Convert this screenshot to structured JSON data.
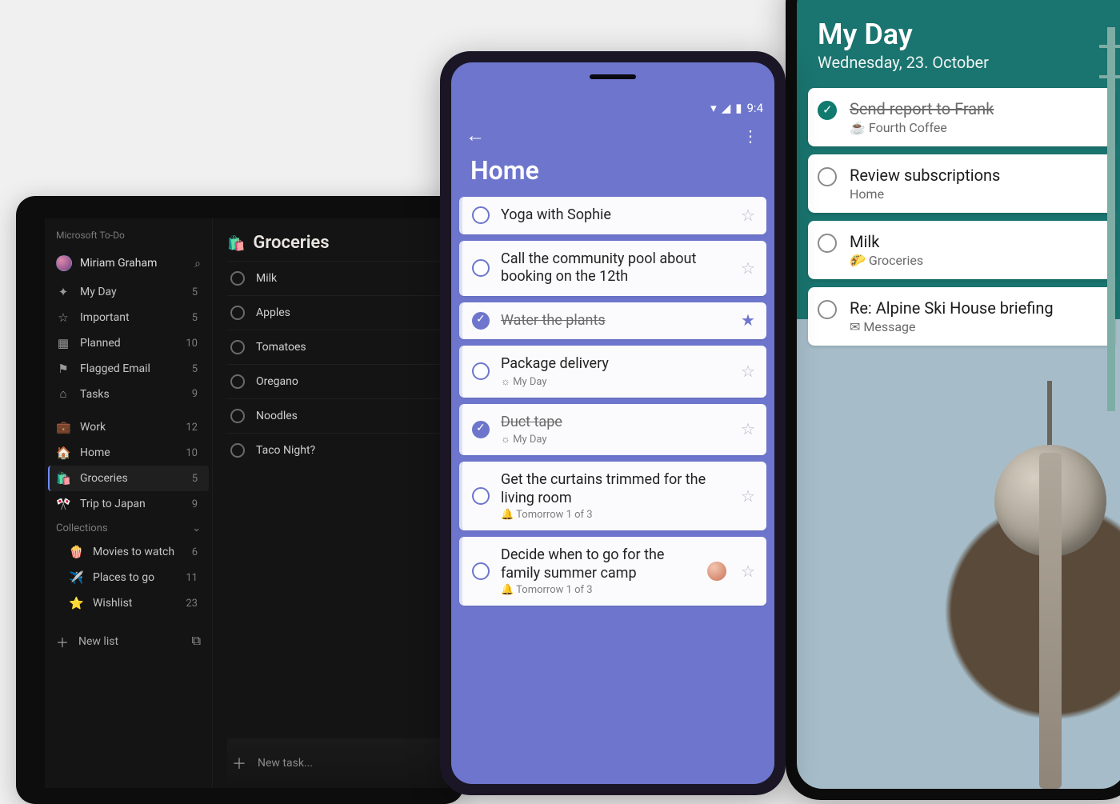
{
  "tablet": {
    "app_title": "Microsoft To-Do",
    "user_name": "Miriam Graham",
    "nav": [
      {
        "icon": "✦",
        "label": "My Day",
        "count": 5
      },
      {
        "icon": "☆",
        "label": "Important",
        "count": 5
      },
      {
        "icon": "▦",
        "label": "Planned",
        "count": 10
      },
      {
        "icon": "⚑",
        "label": "Flagged Email",
        "count": 5
      },
      {
        "icon": "⌂",
        "label": "Tasks",
        "count": 9
      }
    ],
    "lists": [
      {
        "icon": "💼",
        "label": "Work",
        "count": 12,
        "active": false
      },
      {
        "icon": "🏠",
        "label": "Home",
        "count": 10,
        "active": false
      },
      {
        "icon": "🛍️",
        "label": "Groceries",
        "count": 5,
        "active": true
      },
      {
        "icon": "🎌",
        "label": "Trip to Japan",
        "count": 9,
        "active": false
      }
    ],
    "collections_label": "Collections",
    "collections": [
      {
        "icon": "🍿",
        "label": "Movies to watch",
        "count": 6
      },
      {
        "icon": "✈️",
        "label": "Places to go",
        "count": 11
      },
      {
        "icon": "⭐",
        "label": "Wishlist",
        "count": 23
      }
    ],
    "new_list_label": "New list",
    "main": {
      "title": "Groceries",
      "title_icon": "🛍️",
      "tasks": [
        {
          "title": "Milk"
        },
        {
          "title": "Apples"
        },
        {
          "title": "Tomatoes"
        },
        {
          "title": "Oregano"
        },
        {
          "title": "Noodles"
        },
        {
          "title": "Taco Night?"
        }
      ],
      "new_task_placeholder": "New task..."
    }
  },
  "phone1": {
    "status_time": "9:4",
    "list_title": "Home",
    "tasks": [
      {
        "title": "Yoga with Sophie",
        "done": false,
        "star": false
      },
      {
        "title": "Call the community pool about booking on the 12th",
        "done": false,
        "star": false
      },
      {
        "title": "Water the plants",
        "done": true,
        "star": true
      },
      {
        "title": "Package delivery",
        "meta": "☼ My Day",
        "done": false,
        "star": false
      },
      {
        "title": "Duct tape",
        "meta": "☼ My Day",
        "done": true,
        "star": false
      },
      {
        "title": "Get the curtains trimmed for the living room",
        "meta": "🔔 Tomorrow 1 of 3",
        "done": false,
        "star": false
      },
      {
        "title": "Decide when to go for the family summer camp",
        "meta": "🔔 Tomorrow 1 of 3",
        "done": false,
        "star": false,
        "avatar": true
      }
    ]
  },
  "phone2": {
    "title": "My Day",
    "date": "Wednesday, 23. October",
    "tasks": [
      {
        "title": "Send report to Frank",
        "meta": "☕ Fourth Coffee",
        "done": true
      },
      {
        "title": "Review subscriptions",
        "meta": "Home",
        "done": false
      },
      {
        "title": "Milk",
        "meta": "🌮 Groceries",
        "done": false
      },
      {
        "title": "Re: Alpine Ski House briefing",
        "meta": "✉ Message",
        "done": false
      }
    ]
  }
}
